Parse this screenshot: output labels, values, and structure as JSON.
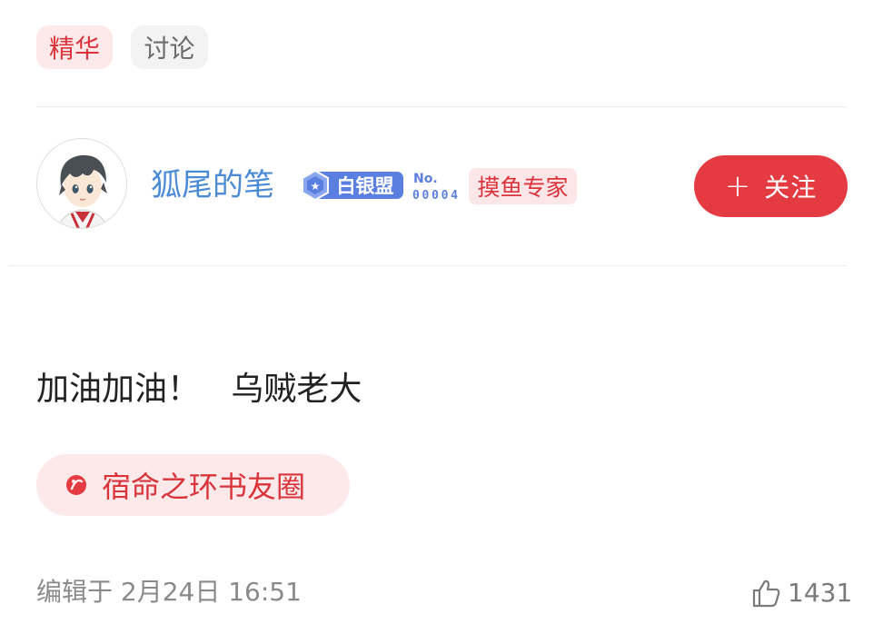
{
  "tags": {
    "featured": "精华",
    "discussion": "讨论"
  },
  "author": {
    "name": "狐尾的笔",
    "silver_badge": "白银盟",
    "no_label": "No.",
    "no_value": "00004",
    "title_badge": "摸鱼专家",
    "follow_label": "关注"
  },
  "post": {
    "content": "加油加油！   乌贼老大",
    "circle": "宿命之环书友圈",
    "edited": "编辑于 2月24日 16:51",
    "likes": "1431"
  },
  "colors": {
    "accent_red": "#e43a42",
    "username_blue": "#4b8bd6",
    "badge_blue": "#5a7fe0"
  },
  "icons": {
    "follow": "plus-icon",
    "circle": "circle-logo-icon",
    "like": "thumbs-up-icon",
    "badge": "star-shield-icon"
  }
}
